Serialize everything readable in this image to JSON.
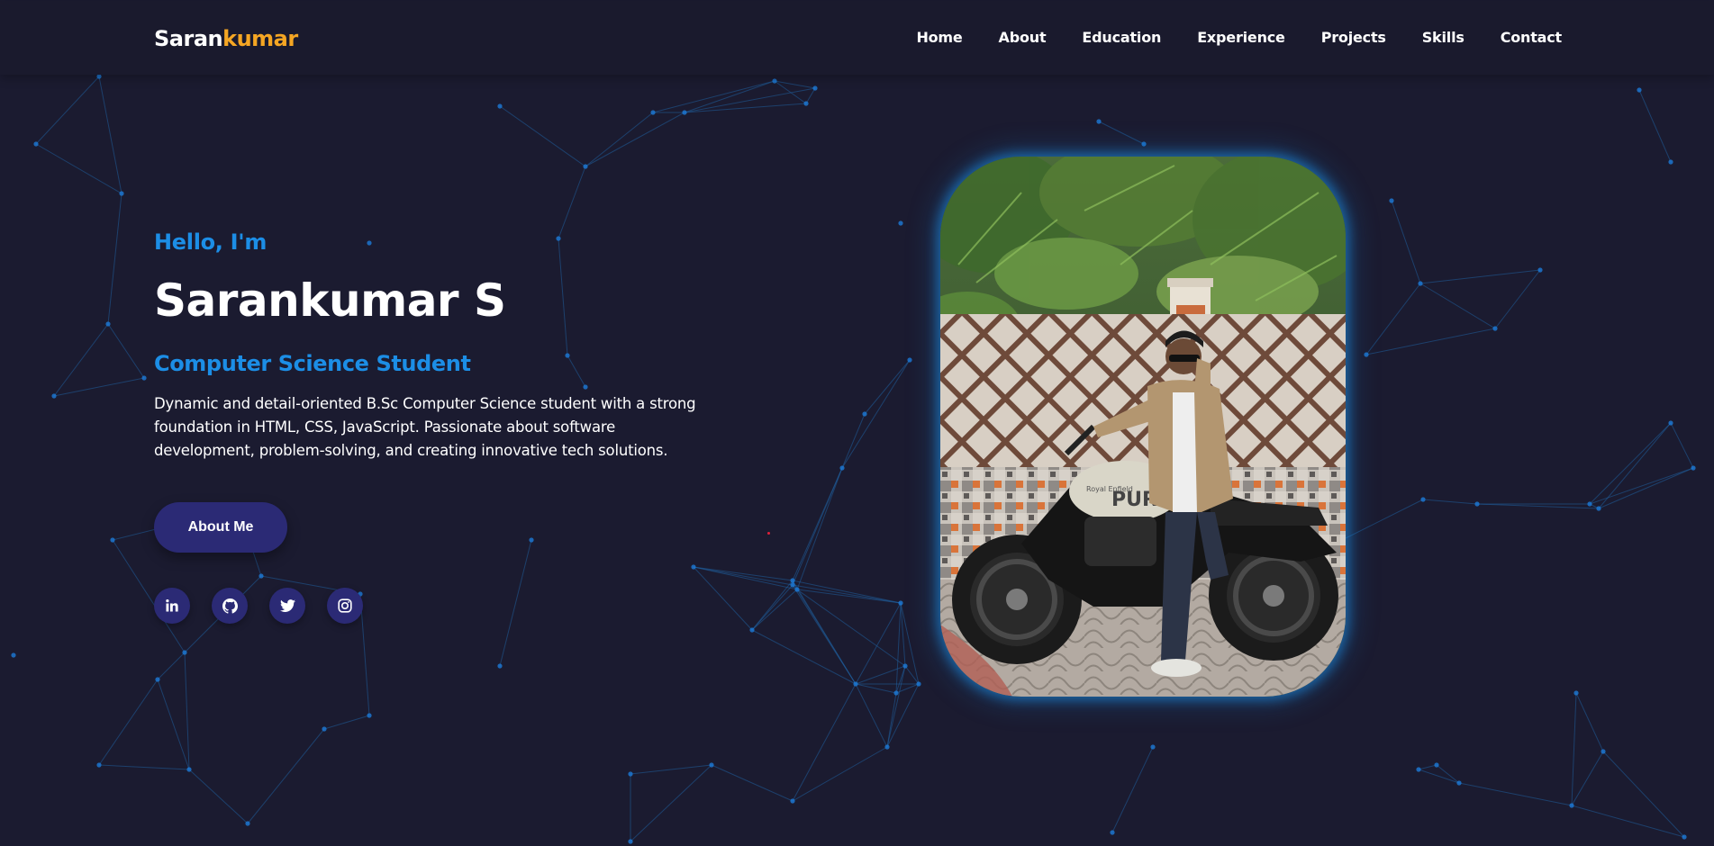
{
  "logo": {
    "first": "Saran",
    "second": "kumar"
  },
  "nav": {
    "items": [
      {
        "label": "Home"
      },
      {
        "label": "About"
      },
      {
        "label": "Education"
      },
      {
        "label": "Experience"
      },
      {
        "label": "Projects"
      },
      {
        "label": "Skills"
      },
      {
        "label": "Contact"
      }
    ]
  },
  "hero": {
    "greeting": "Hello, I'm",
    "name": "Sarankumar S",
    "role": "Computer Science Student",
    "bio": "Dynamic and detail-oriented B.Sc Computer Science student with a strong foundation in HTML, CSS, JavaScript. Passionate about software development, problem-solving, and creating innovative tech solutions.",
    "button_label": "About Me"
  },
  "socials": [
    {
      "icon": "linkedin-icon"
    },
    {
      "icon": "github-icon"
    },
    {
      "icon": "twitter-icon"
    },
    {
      "icon": "instagram-icon"
    }
  ],
  "photo": {
    "bike_tank_text": "PURE",
    "bike_badge_text": "Royal Enfield"
  },
  "colors": {
    "background": "#1b1b30",
    "accent_blue": "#1c8ee6",
    "accent_orange": "#f5a623",
    "button": "#2b2a75"
  }
}
